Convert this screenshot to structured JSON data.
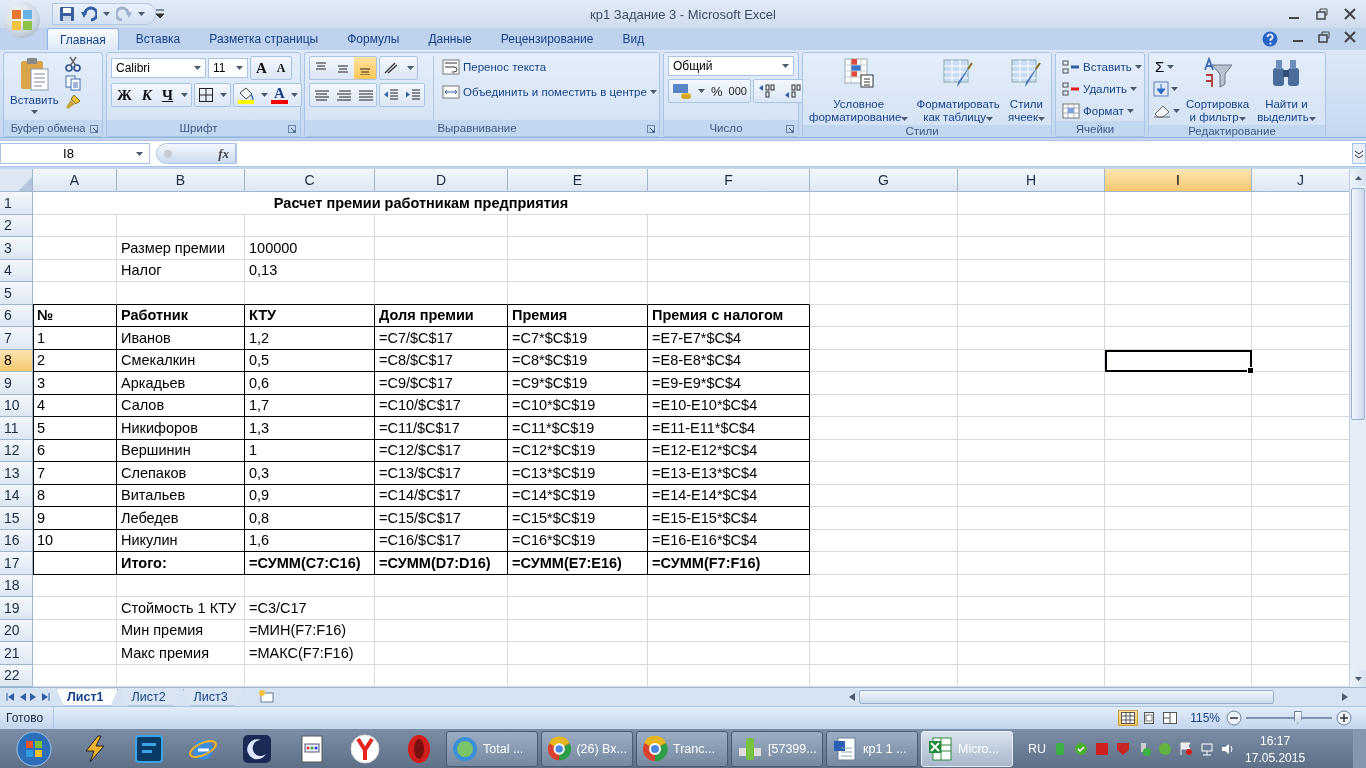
{
  "window": {
    "title": "кр1 Задание 3 - Microsoft Excel"
  },
  "ribbon_tabs": [
    {
      "label": "Главная",
      "selected": true
    },
    {
      "label": "Вставка",
      "selected": false
    },
    {
      "label": "Разметка страницы",
      "selected": false
    },
    {
      "label": "Формулы",
      "selected": false
    },
    {
      "label": "Данные",
      "selected": false
    },
    {
      "label": "Рецензирование",
      "selected": false
    },
    {
      "label": "Вид",
      "selected": false
    }
  ],
  "ribbon": {
    "clipboard": {
      "label": "Буфер обмена",
      "paste": "Вставить"
    },
    "font": {
      "label": "Шрифт",
      "font_name": "Calibri",
      "font_size": "11",
      "grow": "A",
      "shrink": "A",
      "bold": "Ж",
      "italic": "К",
      "underline": "Ч",
      "color_letter": "A"
    },
    "alignment": {
      "label": "Выравнивание",
      "vertical": [
        {
          "selected": false
        },
        {
          "selected": false
        },
        {
          "selected": true
        }
      ],
      "wrap": "Перенос текста",
      "merge": "Объединить и поместить в центре"
    },
    "number": {
      "label": "Число",
      "format": "Общий",
      "percent": "%",
      "thousands": "000"
    },
    "styles": {
      "label": "Стили",
      "buttons": [
        "Условное\nформатирование",
        "Форматировать\nкак таблицу",
        "Стили\nячеек"
      ]
    },
    "cells": {
      "label": "Ячейки",
      "buttons": [
        "Вставить",
        "Удалить",
        "Формат"
      ]
    },
    "editing": {
      "label": "Редактирование",
      "sum": "Σ",
      "buttons": [
        "Сортировка\nи фильтр",
        "Найти и\nвыделить"
      ]
    }
  },
  "formula_bar": {
    "name_box": "I8",
    "fx": "fx"
  },
  "columns": [
    {
      "label": "A",
      "selected": false
    },
    {
      "label": "B",
      "selected": false
    },
    {
      "label": "C",
      "selected": false
    },
    {
      "label": "D",
      "selected": false
    },
    {
      "label": "E",
      "selected": false
    },
    {
      "label": "F",
      "selected": false
    },
    {
      "label": "G",
      "selected": false
    },
    {
      "label": "H",
      "selected": false
    },
    {
      "label": "I",
      "selected": true
    },
    {
      "label": "J",
      "selected": false
    }
  ],
  "rows": [
    {
      "number": "1",
      "selected": false,
      "bold": true,
      "bordered": false,
      "title": "Расчет премии работникам предприятия"
    },
    {
      "number": "2",
      "selected": false,
      "bold": false,
      "bordered": false
    },
    {
      "number": "3",
      "selected": false,
      "bold": false,
      "bordered": false,
      "cells": [
        null,
        "Размер премии",
        "100000"
      ]
    },
    {
      "number": "4",
      "selected": false,
      "bold": false,
      "bordered": false,
      "cells": [
        null,
        "Налог",
        "0,13"
      ]
    },
    {
      "number": "5",
      "selected": false,
      "bold": false,
      "bordered": false
    },
    {
      "number": "6",
      "selected": false,
      "bold": true,
      "bordered": true,
      "cells": [
        "№",
        "Работник",
        "КТУ",
        "Доля премии",
        "Премия",
        "Премия с налогом"
      ]
    },
    {
      "number": "7",
      "selected": false,
      "bold": false,
      "bordered": true,
      "cells": [
        "1",
        "Иванов",
        "1,2",
        "=C7/$C$17",
        "=C7*$C$19",
        "=E7-E7*$C$4"
      ]
    },
    {
      "number": "8",
      "selected": true,
      "bold": false,
      "bordered": true,
      "cells": [
        "2",
        "Смекалкин",
        "0,5",
        "=C8/$C$17",
        "=C8*$C$19",
        "=E8-E8*$C$4"
      ]
    },
    {
      "number": "9",
      "selected": false,
      "bold": false,
      "bordered": true,
      "cells": [
        "3",
        "Аркадьев",
        "0,6",
        "=C9/$C$17",
        "=C9*$C$19",
        "=E9-E9*$C$4"
      ]
    },
    {
      "number": "10",
      "selected": false,
      "bold": false,
      "bordered": true,
      "cells": [
        "4",
        "Салов",
        "1,7",
        "=C10/$C$17",
        "=C10*$C$19",
        "=E10-E10*$C$4"
      ]
    },
    {
      "number": "11",
      "selected": false,
      "bold": false,
      "bordered": true,
      "cells": [
        "5",
        "Никифоров",
        "1,3",
        "=C11/$C$17",
        "=C11*$C$19",
        "=E11-E11*$C$4"
      ]
    },
    {
      "number": "12",
      "selected": false,
      "bold": false,
      "bordered": true,
      "cells": [
        "6",
        "Вершинин",
        "1",
        "=C12/$C$17",
        "=C12*$C$19",
        "=E12-E12*$C$4"
      ]
    },
    {
      "number": "13",
      "selected": false,
      "bold": false,
      "bordered": true,
      "cells": [
        "7",
        "Слепаков",
        "0,3",
        "=C13/$C$17",
        "=C13*$C$19",
        "=E13-E13*$C$4"
      ]
    },
    {
      "number": "14",
      "selected": false,
      "bold": false,
      "bordered": true,
      "cells": [
        "8",
        "Витальев",
        "0,9",
        "=C14/$C$17",
        "=C14*$C$19",
        "=E14-E14*$C$4"
      ]
    },
    {
      "number": "15",
      "selected": false,
      "bold": false,
      "bordered": true,
      "cells": [
        "9",
        "Лебедев",
        "0,8",
        "=C15/$C$17",
        "=C15*$C$19",
        "=E15-E15*$C$4"
      ]
    },
    {
      "number": "16",
      "selected": false,
      "bold": false,
      "bordered": true,
      "cells": [
        "10",
        "Никулин",
        "1,6",
        "=C16/$C$17",
        "=C16*$C$19",
        "=E16-E16*$C$4"
      ]
    },
    {
      "number": "17",
      "selected": false,
      "bold": true,
      "bordered": true,
      "cells": [
        null,
        "Итого:",
        "=СУММ(C7:C16)",
        "=СУММ(D7:D16)",
        "=СУММ(E7:E16)",
        "=СУММ(F7:F16)"
      ]
    },
    {
      "number": "18",
      "selected": false,
      "bold": false,
      "bordered": false
    },
    {
      "number": "19",
      "selected": false,
      "bold": false,
      "bordered": false,
      "cells": [
        null,
        "Стоймость 1 КТУ",
        "=C3/C17"
      ]
    },
    {
      "number": "20",
      "selected": false,
      "bold": false,
      "bordered": false,
      "cells": [
        null,
        "Мин премия",
        "=МИН(F7:F16)"
      ]
    },
    {
      "number": "21",
      "selected": false,
      "bold": false,
      "bordered": false,
      "cells": [
        null,
        "Макс премия",
        "=МАКС(F7:F16)"
      ]
    },
    {
      "number": "22",
      "selected": false,
      "bold": false,
      "bordered": false
    }
  ],
  "sheet_tabs": [
    {
      "label": "Лист1",
      "selected": true
    },
    {
      "label": "Лист2",
      "selected": false
    },
    {
      "label": "Лист3",
      "selected": false
    }
  ],
  "status_bar": {
    "text": "Готово",
    "views": [
      {
        "selected": true
      },
      {
        "selected": false
      },
      {
        "selected": false
      }
    ],
    "zoom": "115%",
    "zoom_slider": {
      "level": 0.6
    }
  },
  "taskbar": {
    "windows": [
      {
        "label": "Total ...",
        "selected": false
      },
      {
        "label": "(26) Вх...",
        "selected": false
      },
      {
        "label": "Tranc...",
        "selected": false
      },
      {
        "label": "[57399...",
        "selected": false
      },
      {
        "label": "кр1 1 ...",
        "selected": false
      },
      {
        "label": "Micro...",
        "selected": true
      }
    ],
    "language": "RU",
    "time": "16:17",
    "date": "17.05.2015"
  }
}
